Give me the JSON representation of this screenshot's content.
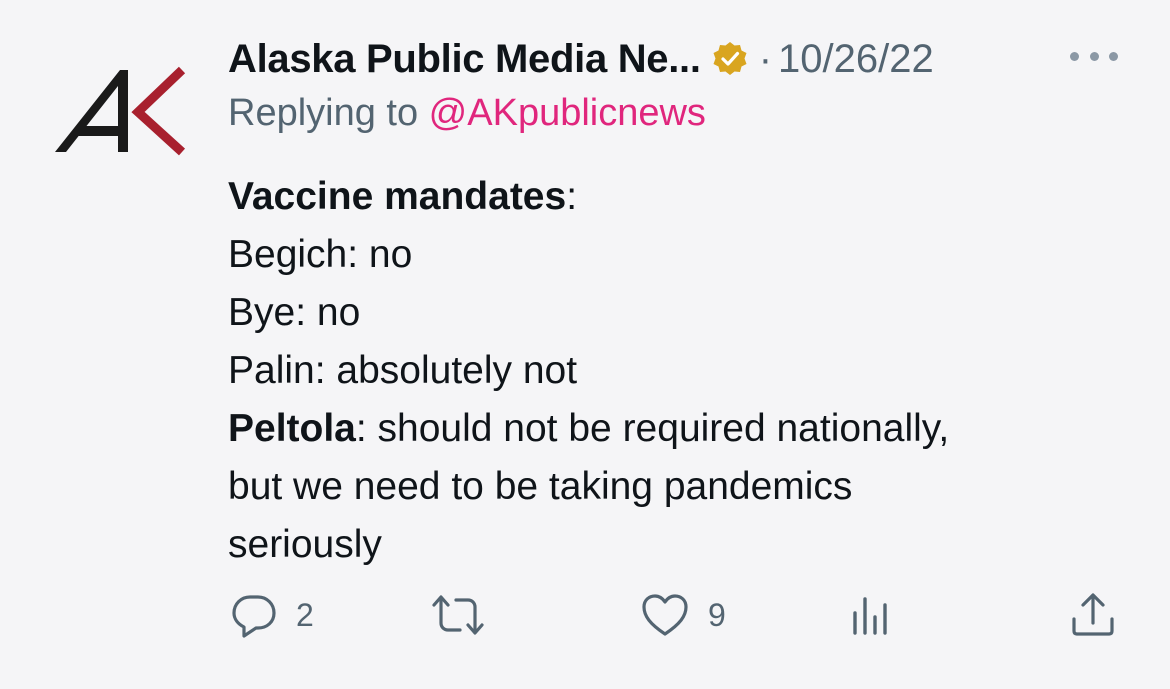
{
  "tweet": {
    "author_name": "Alaska Public Media Ne...",
    "separator": "·",
    "date": "10/26/22",
    "reply_prefix": "Replying to ",
    "reply_handle": "@AKpublicnews",
    "body": {
      "line1_bold": "Vaccine mandates",
      "line1_rest": ":",
      "line2": "Begich: no",
      "line3": "Bye: no",
      "line4": "Palin: absolutely not",
      "line5_bold": "Peltola",
      "line5_rest": ": should not be required nationally,",
      "line6": "but we need to be taking pandemics",
      "line7": "seriously"
    },
    "actions": {
      "reply_count": "2",
      "like_count": "9"
    }
  },
  "colors": {
    "background": "#f5f5f7",
    "text": "#0f1419",
    "secondary": "#536471",
    "mention": "#e0267d",
    "badge": "#d9a520",
    "logo_red": "#a8202e"
  },
  "icons": {
    "avatar": "ak-logo",
    "badge": "verified-gold-badge-icon",
    "more": "more-horizontal-icon",
    "reply": "reply-bubble-icon",
    "retweet": "retweet-icon",
    "like": "heart-icon",
    "views": "analytics-bars-icon",
    "share": "share-upload-icon"
  }
}
